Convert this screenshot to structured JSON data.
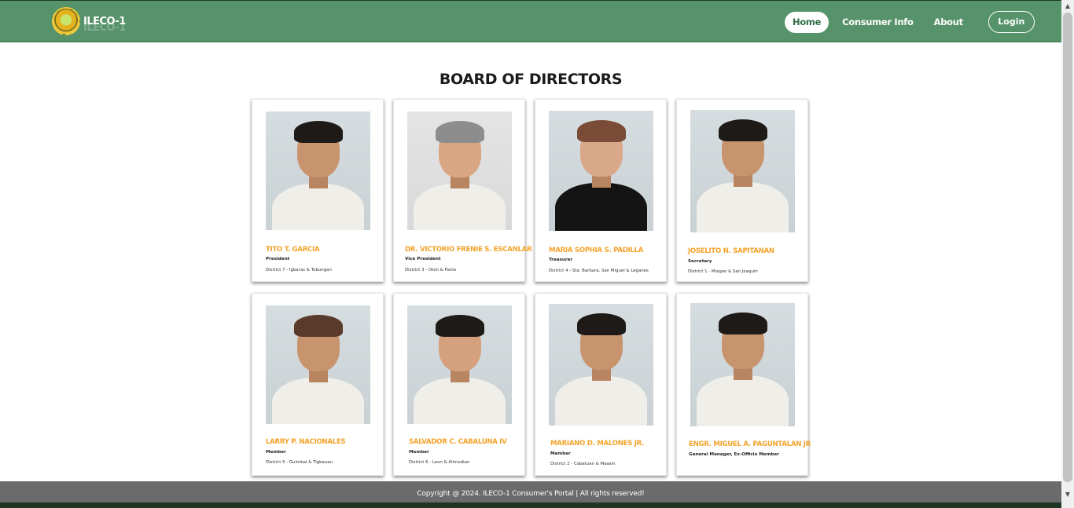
{
  "header": {
    "logo_text": "ILECO-1",
    "nav": {
      "home": "Home",
      "consumer_info": "Consumer Info",
      "about": "About",
      "login": "Login"
    }
  },
  "main": {
    "title": "BOARD OF DIRECTORS",
    "directors": [
      {
        "name": "TITO T. GARCIA",
        "role": "President",
        "district": "District 7 - Igbaras & Tubungan"
      },
      {
        "name": "DR. VICTORIO FRENIE S. ESCANLAR",
        "role": "Vice President",
        "district": "District 3 - Oton & Pavia"
      },
      {
        "name": "MARIA SOPHIA S. PADILLA",
        "role": "Treasurer",
        "district": "District 4 - Sta. Barbara, San Miguel & Leganes"
      },
      {
        "name": "JOSELITO N. SAPITANAN",
        "role": "Secretary",
        "district": "District 1 - Miagao & San Joaquin"
      },
      {
        "name": "LARRY P. NACIONALES",
        "role": "Member",
        "district": "District 5 - Guimbal & Tigbauan"
      },
      {
        "name": "SALVADOR C. CABALUNA IV",
        "role": "Member",
        "district": "District 6 - Leon & Alimodian"
      },
      {
        "name": "MARIANO D. MALONES JR.",
        "role": "Member",
        "district": "District 2 - Cabatuan & Maasin"
      },
      {
        "name": "ENGR. MIGUEL A. PAGUNTALAN JR",
        "role": "General Manager, Ex-Officio Member",
        "district": ""
      }
    ]
  },
  "footer": {
    "text": "Copyright @ 2024. ILECO-1 Consumer's Portal | All rights reserved!"
  },
  "colors": {
    "navbar": "#56926a",
    "name_accent": "#f3a32a",
    "footer": "#6b6b6b"
  }
}
